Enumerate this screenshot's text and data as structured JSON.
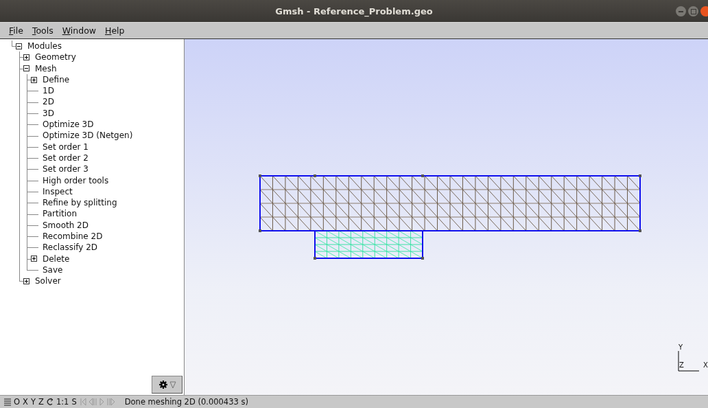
{
  "window": {
    "title": "Gmsh - Reference_Problem.geo"
  },
  "menu": [
    "File",
    "Tools",
    "Window",
    "Help"
  ],
  "tree": [
    {
      "label": "Modules",
      "expanded": true,
      "children": [
        {
          "label": "Geometry",
          "expanded": false
        },
        {
          "label": "Mesh",
          "expanded": true,
          "children": [
            {
              "label": "Define",
              "expanded": false
            },
            {
              "label": "1D"
            },
            {
              "label": "2D"
            },
            {
              "label": "3D"
            },
            {
              "label": "Optimize 3D"
            },
            {
              "label": "Optimize 3D (Netgen)"
            },
            {
              "label": "Set order 1"
            },
            {
              "label": "Set order 2"
            },
            {
              "label": "Set order 3"
            },
            {
              "label": "High order tools"
            },
            {
              "label": "Inspect"
            },
            {
              "label": "Refine by splitting"
            },
            {
              "label": "Partition"
            },
            {
              "label": "Smooth 2D"
            },
            {
              "label": "Recombine 2D"
            },
            {
              "label": "Reclassify 2D"
            },
            {
              "label": "Delete",
              "expanded": false
            },
            {
              "label": "Save"
            }
          ]
        },
        {
          "label": "Solver",
          "expanded": false
        }
      ]
    }
  ],
  "axes": {
    "y": "Y",
    "z": "Z",
    "x": "X"
  },
  "status_bar": {
    "view_buttons": [
      "O",
      "X",
      "Y",
      "Z"
    ],
    "scale": "1:1",
    "s_button": "S",
    "message": "Done meshing 2D (0.000433 s)"
  }
}
